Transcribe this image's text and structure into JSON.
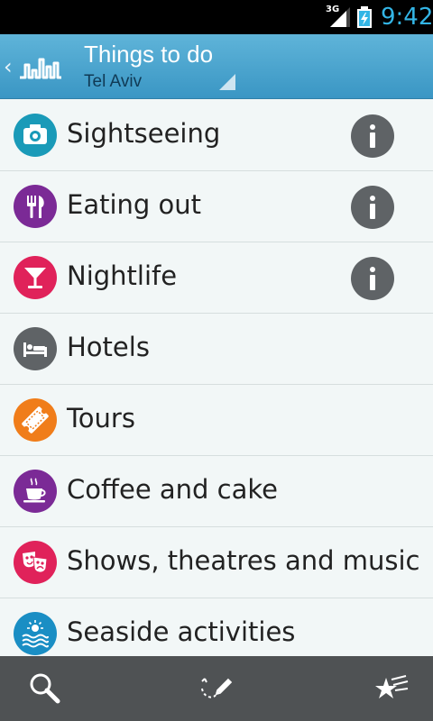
{
  "status_bar": {
    "network": "3G",
    "time": "9:42"
  },
  "header": {
    "back_icon": "chevron-left-icon",
    "logo_icon": "app-logo-icon",
    "title": "Things to do",
    "subtitle": "Tel Aviv"
  },
  "list": {
    "items": [
      {
        "label": "Sightseeing",
        "icon": "camera-icon",
        "color": "#1a9ab8",
        "has_info": true
      },
      {
        "label": "Eating out",
        "icon": "cutlery-icon",
        "color": "#7b2a96",
        "has_info": true
      },
      {
        "label": "Nightlife",
        "icon": "cocktail-icon",
        "color": "#e0225a",
        "has_info": true
      },
      {
        "label": "Hotels",
        "icon": "bed-icon",
        "color": "#5f6366",
        "has_info": false
      },
      {
        "label": "Tours",
        "icon": "ticket-icon",
        "color": "#f07d1a",
        "has_info": false
      },
      {
        "label": "Coffee and cake",
        "icon": "coffee-cup-icon",
        "color": "#7b2a96",
        "has_info": false
      },
      {
        "label": "Shows, theatres and music",
        "icon": "theatre-masks-icon",
        "color": "#e0225a",
        "has_info": false
      },
      {
        "label": "Seaside activities",
        "icon": "sun-waves-icon",
        "color": "#1a8ec4",
        "has_info": false
      }
    ]
  },
  "bottom_bar": {
    "search_icon": "search-icon",
    "route_icon": "pencil-route-icon",
    "favorites_icon": "favorites-stars-icon"
  }
}
